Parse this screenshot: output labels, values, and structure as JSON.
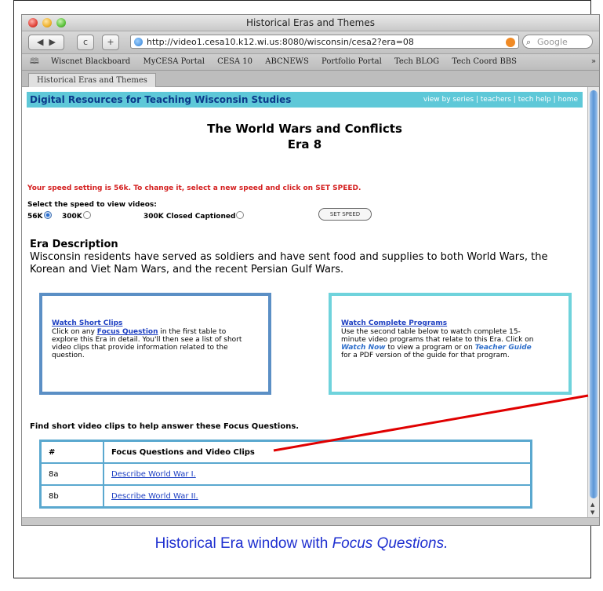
{
  "window": {
    "title": "Historical Eras and Themes",
    "back_label": "◀",
    "forward_label": "▶",
    "reload_label": "c",
    "add_label": "+",
    "url": "http://video1.cesa10.k12.wi.us:8080/wisconsin/cesa2?era=08",
    "search_placeholder": "Google",
    "bookmarks": [
      "Wiscnet Blackboard",
      "MyCESA Portal",
      "CESA 10",
      "ABCNEWS",
      "Portfolio Portal",
      "Tech BLOG",
      "Tech Coord BBS"
    ],
    "bookmarks_more": "»",
    "tab_label": "Historical Eras and Themes"
  },
  "page": {
    "site_title": "Digital Resources for Teaching Wisconsin Studies",
    "nav_links": "view by series | teachers | tech help | home",
    "heading": "The World Wars and Conflicts",
    "subheading": "Era 8",
    "speed_message": "Your speed setting is 56k. To change it, select a new speed and click on SET SPEED.",
    "speed_prompt": "Select the speed to view videos:",
    "speed_options": [
      "56K",
      "300K",
      "300K Closed Captioned"
    ],
    "speed_selected": "56K",
    "set_speed_label": "SET SPEED",
    "era_description_heading": "Era Description",
    "era_description": "Wisconsin residents have served as soldiers and have sent food and supplies to both World Wars, the Korean and Viet Nam Wars, and the recent Persian Gulf Wars.",
    "box1": {
      "title": "Watch Short Clips",
      "line1_a": "Click on any ",
      "line1_link": "Focus Question",
      "line1_b": " in the first table to",
      "line2": "explore this Era in detail. You'll then see a list of short",
      "line3": "video clips that provide information related to the",
      "line4": "question."
    },
    "box2": {
      "title": "Watch Complete Programs",
      "line1": "Use the second table below to watch complete 15-",
      "line2": "minute video programs that relate to this Era. Click on",
      "line3_em1": "Watch Now",
      "line3_mid": " to view a program or on ",
      "line3_em2": "Teacher Guide",
      "line4": "for a PDF version of the guide for that program."
    },
    "find_heading": "Find short video clips to help answer these Focus Questions.",
    "table": {
      "headers": [
        "#",
        "Focus Questions and Video Clips"
      ],
      "rows": [
        {
          "id": "8a",
          "question": "Describe World War I."
        },
        {
          "id": "8b",
          "question": "Describe World War II."
        }
      ]
    }
  },
  "caption": {
    "plain": "Historical Era window with ",
    "italic": "Focus Questions."
  },
  "colors": {
    "site_bar": "#5ec8d8",
    "speed_message": "#d42020",
    "box1_border": "#5b8fc5",
    "box2_border": "#6fd3dc",
    "table_border": "#5aa8cf",
    "link": "#1d3fc2",
    "caption": "#1e2fd0",
    "arrow": "#e00000"
  }
}
